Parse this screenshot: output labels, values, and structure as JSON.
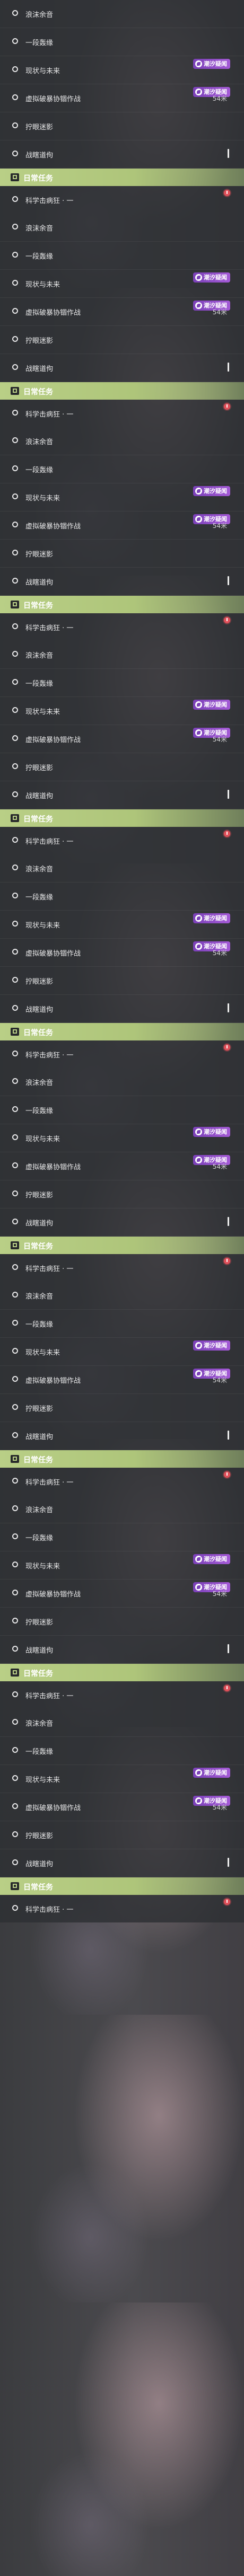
{
  "blocks": [
    {
      "items": [
        {
          "label": "浪沫余音",
          "badge": null,
          "distance": null
        },
        {
          "label": "一段轰缘",
          "badge": null,
          "distance": null
        },
        {
          "label": "现状与未来",
          "badge": "潮汐疑闻",
          "distance": null
        },
        {
          "label": "虚拟破暴协锢作战",
          "badge": "潮汐疑闻",
          "distance": "54米"
        },
        {
          "label": "拧眼迷影",
          "badge": null,
          "distance": null
        },
        {
          "label": "战瞎道佝",
          "badge": null,
          "distance": null
        }
      ],
      "section_title": "日常任务",
      "task": "科学击病狂 · 一"
    },
    {
      "items": [
        {
          "label": "浪沫余音",
          "badge": null,
          "distance": null
        },
        {
          "label": "一段轰缘",
          "badge": null,
          "distance": null
        },
        {
          "label": "现状与未来",
          "badge": "潮汐疑闻",
          "distance": null
        },
        {
          "label": "虚拟破暴协锢作战",
          "badge": "潮汐疑闻",
          "distance": "54米"
        },
        {
          "label": "拧眼迷影",
          "badge": null,
          "distance": null
        },
        {
          "label": "战瞎道佝",
          "badge": null,
          "distance": null
        }
      ],
      "section_title": "日常任务",
      "task": "科学击病狂 · 一"
    },
    {
      "items": [
        {
          "label": "浪沫余音",
          "badge": null,
          "distance": null
        },
        {
          "label": "一段轰缘",
          "badge": null,
          "distance": null
        },
        {
          "label": "现状与未来",
          "badge": "潮汐疑闻",
          "distance": null
        },
        {
          "label": "虚拟破暴协锢作战",
          "badge": "潮汐疑闻",
          "distance": "54米"
        },
        {
          "label": "拧眼迷影",
          "badge": null,
          "distance": null
        },
        {
          "label": "战瞎道佝",
          "badge": null,
          "distance": null
        }
      ],
      "section_title": "日常任务",
      "task": "科学击病狂 · 一"
    },
    {
      "items": [
        {
          "label": "浪沫余音",
          "badge": null,
          "distance": null
        },
        {
          "label": "一段轰缘",
          "badge": null,
          "distance": null
        },
        {
          "label": "现状与未来",
          "badge": "潮汐疑闻",
          "distance": null
        },
        {
          "label": "虚拟破暴协锢作战",
          "badge": "潮汐疑闻",
          "distance": "54米"
        },
        {
          "label": "拧眼迷影",
          "badge": null,
          "distance": null
        },
        {
          "label": "战瞎道佝",
          "badge": null,
          "distance": null
        }
      ],
      "section_title": "日常任务",
      "task": "科学击病狂 · 一"
    },
    {
      "items": [
        {
          "label": "浪沫余音",
          "badge": null,
          "distance": null
        },
        {
          "label": "一段轰缘",
          "badge": null,
          "distance": null
        },
        {
          "label": "现状与未来",
          "badge": "潮汐疑闻",
          "distance": null
        },
        {
          "label": "虚拟破暴协锢作战",
          "badge": "潮汐疑闻",
          "distance": "54米"
        },
        {
          "label": "拧眼迷影",
          "badge": null,
          "distance": null
        },
        {
          "label": "战瞎道佝",
          "badge": null,
          "distance": null
        }
      ],
      "section_title": "日常任务",
      "task": "科学击病狂 · 一"
    },
    {
      "items": [
        {
          "label": "浪沫余音",
          "badge": null,
          "distance": null
        },
        {
          "label": "一段轰缘",
          "badge": null,
          "distance": null
        },
        {
          "label": "现状与未来",
          "badge": "潮汐疑闻",
          "distance": null
        },
        {
          "label": "虚拟破暴协锢作战",
          "badge": "潮汐疑闻",
          "distance": "54米"
        },
        {
          "label": "拧眼迷影",
          "badge": null,
          "distance": null
        },
        {
          "label": "战瞎道佝",
          "badge": null,
          "distance": null
        }
      ],
      "section_title": "日常任务",
      "task": "科学击病狂 · 一"
    },
    {
      "items": [
        {
          "label": "浪沫余音",
          "badge": null,
          "distance": null
        },
        {
          "label": "一段轰缘",
          "badge": null,
          "distance": null
        },
        {
          "label": "现状与未来",
          "badge": "潮汐疑闻",
          "distance": null
        },
        {
          "label": "虚拟破暴协锢作战",
          "badge": "潮汐疑闻",
          "distance": "54米"
        },
        {
          "label": "拧眼迷影",
          "badge": null,
          "distance": null
        },
        {
          "label": "战瞎道佝",
          "badge": null,
          "distance": null
        }
      ],
      "section_title": "日常任务",
      "task": "科学击病狂 · 一"
    },
    {
      "items": [
        {
          "label": "浪沫余音",
          "badge": null,
          "distance": null
        },
        {
          "label": "一段轰缘",
          "badge": null,
          "distance": null
        },
        {
          "label": "现状与未来",
          "badge": "潮汐疑闻",
          "distance": null
        },
        {
          "label": "虚拟破暴协锢作战",
          "badge": "潮汐疑闻",
          "distance": "54米"
        },
        {
          "label": "拧眼迷影",
          "badge": null,
          "distance": null
        },
        {
          "label": "战瞎道佝",
          "badge": null,
          "distance": null
        }
      ],
      "section_title": "日常任务",
      "task": "科学击病狂 · 一"
    },
    {
      "items": [
        {
          "label": "浪沫余音",
          "badge": null,
          "distance": null
        },
        {
          "label": "一段轰缘",
          "badge": null,
          "distance": null
        },
        {
          "label": "现状与未来",
          "badge": "潮汐疑闻",
          "distance": null
        },
        {
          "label": "虚拟破暴协锢作战",
          "badge": "潮汐疑闻",
          "distance": "54米"
        },
        {
          "label": "拧眼迷影",
          "badge": null,
          "distance": null
        },
        {
          "label": "战瞎道佝",
          "badge": null,
          "distance": null
        }
      ],
      "section_title": "日常任务",
      "task": "科学击病狂 · 一"
    }
  ],
  "colors": {
    "badge": "#8a4cc6",
    "section_header": "#b9cf86",
    "alert": "#e0505a"
  },
  "icons": {
    "item": "circle-icon",
    "badge": "tide-icon",
    "section": "quest-icon",
    "alert": "alert-icon"
  }
}
